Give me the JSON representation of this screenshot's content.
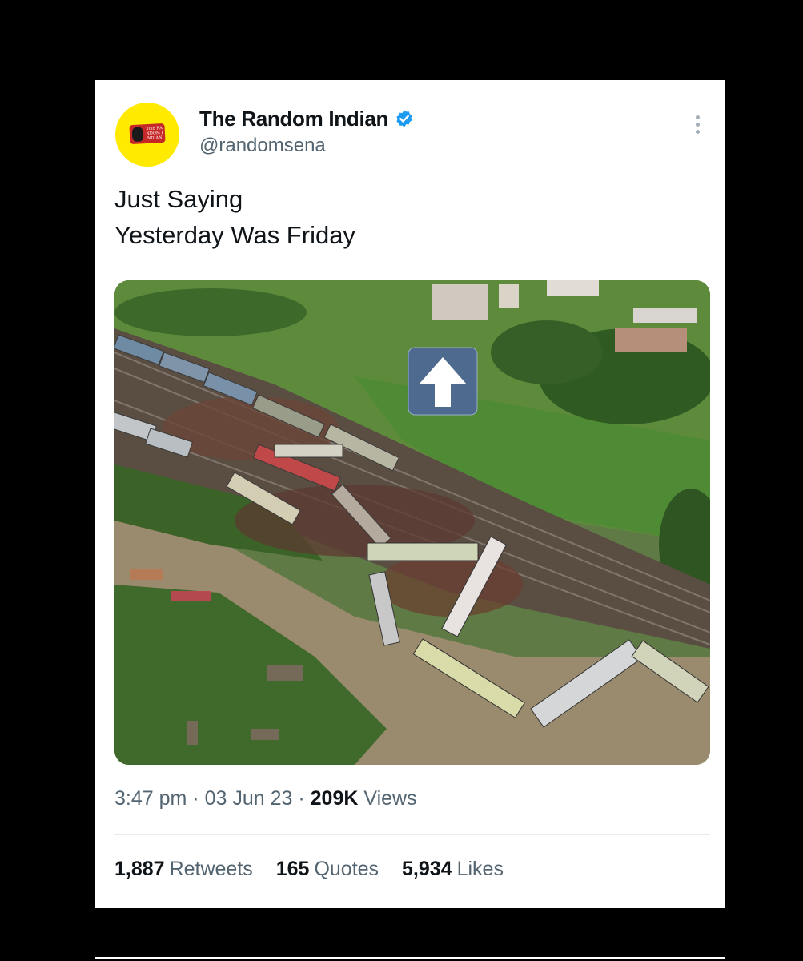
{
  "tweet": {
    "author": {
      "name": "The Random Indian",
      "handle": "@randomsena",
      "verified": true,
      "avatar_logo_text": "THE RANDOM INDIAN"
    },
    "text_lines": [
      "Just Saying",
      "Yesterday Was Friday"
    ],
    "time": "3:47 pm",
    "date": "03 Jun 23",
    "views_count": "209K",
    "views_label": "Views",
    "stats": [
      {
        "value": "1,887",
        "label": "Retweets"
      },
      {
        "value": "165",
        "label": "Quotes"
      },
      {
        "value": "5,934",
        "label": "Likes"
      }
    ],
    "media": {
      "alt_icon": "up-arrow-icon"
    }
  },
  "colors": {
    "text_primary": "#0f1419",
    "text_secondary": "#536471",
    "verified_blue": "#1d9bf0",
    "avatar_yellow": "#ffea00",
    "divider": "#e6ecf0"
  }
}
